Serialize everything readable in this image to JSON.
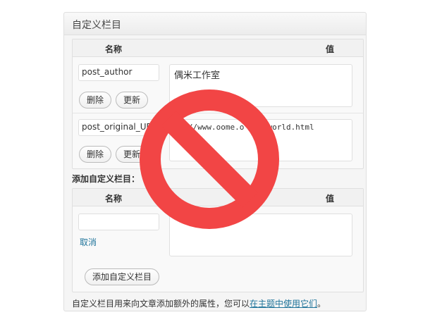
{
  "metabox": {
    "title": "自定义栏目"
  },
  "existing": {
    "header_name": "名称",
    "header_value": "值",
    "rows": [
      {
        "key": "post_author",
        "value": "偶米工作室",
        "delete_label": "删除",
        "update_label": "更新"
      },
      {
        "key": "post_original_UR",
        "value": "tp://www.oome.o     llo-world.html",
        "delete_label": "删除",
        "update_label": "更新"
      }
    ]
  },
  "add_new": {
    "title": "添加自定义栏目：",
    "header_name": "名称",
    "header_value": "值",
    "key_value": "",
    "value_value": "",
    "cancel_label": "取消",
    "submit_label": "添加自定义栏目"
  },
  "help": {
    "text": "自定义栏目用来向文章添加额外的属性，您可以",
    "link": "在主题中使用它们",
    "end": "。"
  },
  "overlay": {
    "icon": "forbidden-icon",
    "color": "#f24545"
  }
}
